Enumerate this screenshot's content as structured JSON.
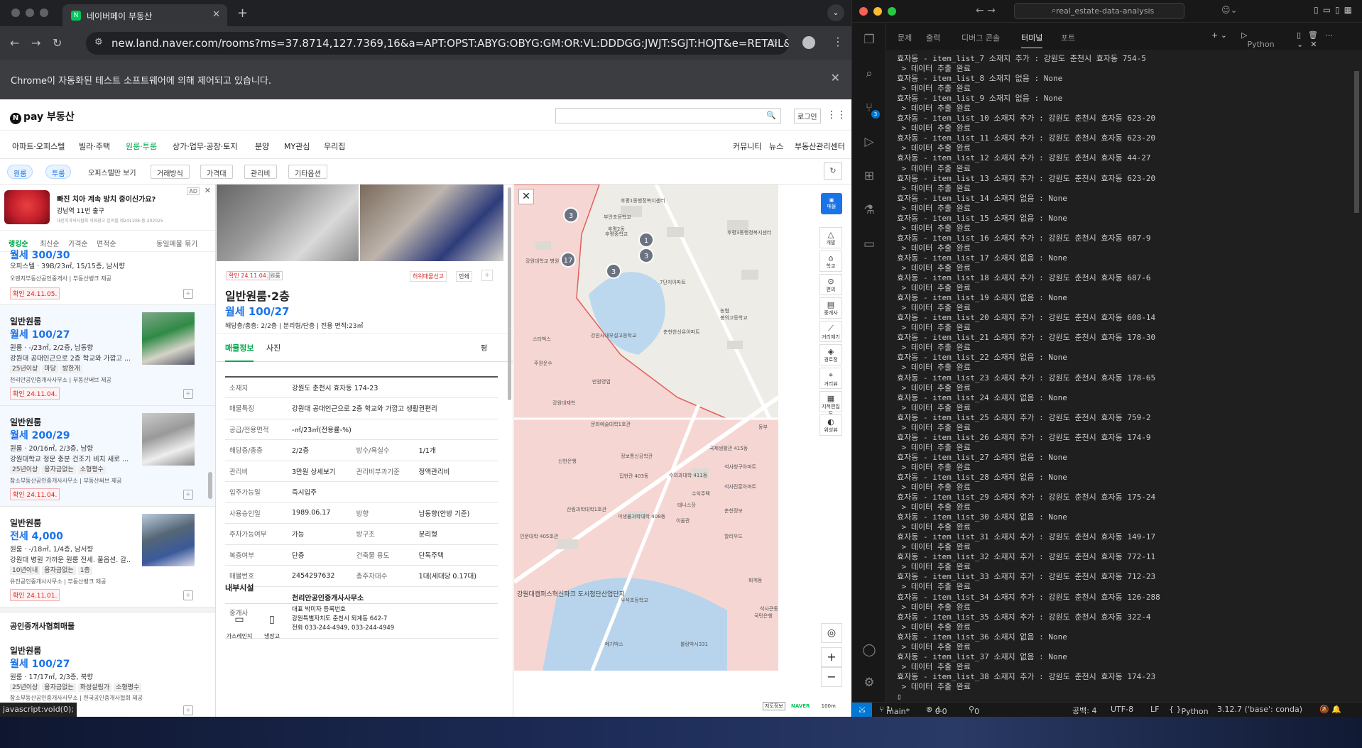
{
  "chrome": {
    "tab_title": "네이버페이 부동산",
    "url": "new.land.naver.com/rooms?ms=37.8714,127.7369,16&a=APT:OPST:ABYG:OBYG:GM:OR:VL:DDDGG:JWJT:SGJT:HOJT&e=RETAIL&aa=S...",
    "infobar": "Chrome이 자동화된 테스트 소프트웨어에 의해 제어되고 있습니다.",
    "status_url": "javascript:void(0);"
  },
  "naver": {
    "logo": "pay 부동산",
    "login": "로그인",
    "menu": [
      "아파트·오피스텔",
      "빌라·주택",
      "원룸·투룸",
      "상가·업무·공장·토지",
      "분양",
      "MY관심",
      "우리집"
    ],
    "menu_right": [
      "커뮤니티",
      "뉴스",
      "부동산관리센터"
    ],
    "filters": [
      "원룸",
      "투룸",
      "오피스텔만 보기",
      "거래방식",
      "가격대",
      "관리비",
      "기타옵션"
    ],
    "ad": {
      "title": "빠진 치아 계속 방치 중이신가요?",
      "sub": "강남역 11번 출구",
      "fine": "대한치과의사협회 의료광고 심의필 제241108-중-202025",
      "tag": "AD"
    },
    "sort": [
      "랭킹순",
      "최신순",
      "가격순",
      "면적순",
      "동일매물 묶기"
    ],
    "partial": {
      "price": "월세 300/30",
      "spec": "오피스텔 · 39B/23㎡, 15/15층, 남서향",
      "agent": "오렌지부동산공인중개사 | 부동산뱅크 제공",
      "confirm": "확인 24.11.05."
    },
    "listings": [
      {
        "title": "일반원룸",
        "price": "월세 100/27",
        "spec": "원룸 · -/23㎡, 2/2층, 남동향",
        "desc": "강원대 공대인근으로 2층 학교와 가깝고 ...",
        "tags": [
          "25년이상",
          "마당",
          "방한개"
        ],
        "agent": "천리안공인중개사사무소 | 부동산써브 제공",
        "confirm": "확인 24.11.04."
      },
      {
        "title": "일반원룸",
        "price": "월세 200/29",
        "spec": "원룸 · 20/16㎡, 2/3층, 남향",
        "desc": "강원대학교 정문 충분 건조기 비치 새로 ...",
        "tags": [
          "25년이상",
          "융자금없는",
          "소형평수"
        ],
        "agent": "참소부동산공인중개사사무소 | 부동산써브 제공",
        "confirm": "확인 24.11.04."
      },
      {
        "title": "일반원룸",
        "price": "전세 4,000",
        "spec": "원룸 · -/18㎡, 1/4층, 남서향",
        "desc": "강원대 병원 가까운 원룸 전세. 풀옵션. 갈...",
        "tags": [
          "10년이내",
          "융자금없는",
          "1층"
        ],
        "agent": "유진공인중개사사무소 | 부동산뱅크 제공",
        "confirm": "확인 24.11.01."
      }
    ],
    "section": "공인중개사협회매물",
    "bottom_listing": {
      "title": "일반원룸",
      "price": "월세 100/27",
      "spec": "원룸 · 17/17㎡, 2/3층, 북향",
      "tags": [
        "25년이상",
        "융자금없는",
        "화성살림가",
        "소형평수"
      ],
      "agent": "참소부동산공인중개사사무소 | 한국공인중개사협회 제공"
    },
    "detail": {
      "badge": "확인 24.11.04.",
      "badge2": "원룸",
      "report": "허위매물신고",
      "print": "인쇄",
      "title": "일반원룸·2층",
      "price": "월세 100/27",
      "summary": "해당층/총층: 2/2층 | 분리형/단층 | 전용 면적:23㎡",
      "tab1": "매물정보",
      "tab2": "사진",
      "pyeong": "평",
      "rows": [
        {
          "k": "소재지",
          "v": "강원도 춘천시 효자동 174-23"
        },
        {
          "k": "매물특징",
          "v": "강원대 공대인근으로 2층 학교와 가깝고 생활권편리"
        },
        {
          "k": "공급/전용면적",
          "v": "-㎡/23㎡(전용률-%)"
        },
        {
          "k": "해당층/총층",
          "v": "2/2층",
          "k2": "방수/욕실수",
          "v2": "1/1개"
        },
        {
          "k": "관리비",
          "v": "3만원 상세보기",
          "k2": "관리비부과기준",
          "v2": "정액관리비"
        },
        {
          "k": "입주가능일",
          "v": "즉시입주"
        },
        {
          "k": "사용승인일",
          "v": "1989.06.17",
          "k2": "방향",
          "v2": "남동향(안방 기준)"
        },
        {
          "k": "주차가능여부",
          "v": "가능",
          "k2": "방구조",
          "v2": "분리형"
        },
        {
          "k": "복층여부",
          "v": "단층",
          "k2": "건축물 용도",
          "v2": "단독주택"
        },
        {
          "k": "매물번호",
          "v": "2454297632",
          "k2": "총주차대수",
          "v2": "1대(세대당 0.17대)"
        }
      ],
      "agent_key": "중개사",
      "agent_name": "천리안공인중개사사무소",
      "agent_lines": [
        "대표 박미자 등록번호",
        "강원특별자치도 춘천시 퇴계동 642-7",
        "전화 033-244-4949, 033-244-4949"
      ],
      "inner": "내부시설",
      "facilities": [
        "가스레인지",
        "냉장고"
      ]
    },
    "map": {
      "labels": [
        "스타벅스",
        "강원대학교 병원",
        "주원운수",
        "강원사대부설고등학교",
        "후평2동",
        "부안초등학교",
        "후평중학교",
        "7단지아파트",
        "춘천한신유아파트",
        "봉의고등학교",
        "농협",
        "강원대재학",
        "만원영업",
        "문화예술대학1호관",
        "정보통신공학관",
        "신한은행",
        "집현관 403동",
        "수의과대학 411동",
        "수익주택",
        "인문대학 405호관",
        "산림과학대학1호관",
        "미생물과학대학 408동",
        "국제생활관 415동",
        "테니스장",
        "이울관",
        "석사청구아파트",
        "석사진흥아파트",
        "춘천정보",
        "할리우드",
        "석사큰동",
        "우석초등학교",
        "국민은행",
        "메가박스",
        "불랑박시331",
        "강원대캠퍼스혁신파크 도시첨단산업단지",
        "후평1동행정복지센터",
        "후평3동행정복지센터",
        "동부",
        "퇴계동"
      ],
      "clusters": [
        "3",
        "1",
        "3",
        "17",
        "3"
      ],
      "controls": [
        "매물",
        "개발",
        "학교",
        "편의",
        "중개사",
        "거리재기",
        "경로정",
        "거리뷰",
        "지적편집도",
        "위성뷰"
      ],
      "footer": [
        "지도정보",
        "NAVER",
        "100m"
      ]
    }
  },
  "vscode": {
    "search": "real_estate-data-analysis",
    "panel_tabs": [
      "문제",
      "출력",
      "디버그 콘솔",
      "터미널",
      "포트"
    ],
    "terminal_right": "Python",
    "status": {
      "branch": "main*",
      "errors": "0",
      "warnings": "0",
      "ports": "0",
      "spaces": "공백: 4",
      "encoding": "UTF-8",
      "eol": "LF",
      "lang": "Python",
      "interp": "3.12.7 ('base': conda)"
    },
    "terminal_lines": [
      "효자동 - item_list_7 소재지 추가 : 강원도 춘천시 효자동 754-5",
      " > 데이터 추출 완료",
      "효자동 - item_list_8 소재지 없음 : None",
      " > 데이터 추출 완료",
      "효자동 - item_list_9 소재지 없음 : None",
      " > 데이터 추출 완료",
      "효자동 - item_list_10 소재지 추가 : 강원도 춘천시 효자동 623-20",
      " > 데이터 추출 완료",
      "효자동 - item_list_11 소재지 추가 : 강원도 춘천시 효자동 623-20",
      " > 데이터 추출 완료",
      "효자동 - item_list_12 소재지 추가 : 강원도 춘천시 효자동 44-27",
      " > 데이터 추출 완료",
      "효자동 - item_list_13 소재지 추가 : 강원도 춘천시 효자동 623-20",
      " > 데이터 추출 완료",
      "효자동 - item_list_14 소재지 없음 : None",
      " > 데이터 추출 완료",
      "효자동 - item_list_15 소재지 없음 : None",
      " > 데이터 추출 완료",
      "효자동 - item_list_16 소재지 추가 : 강원도 춘천시 효자동 687-9",
      " > 데이터 추출 완료",
      "효자동 - item_list_17 소재지 없음 : None",
      " > 데이터 추출 완료",
      "효자동 - item_list_18 소재지 추가 : 강원도 춘천시 효자동 687-6",
      " > 데이터 추출 완료",
      "효자동 - item_list_19 소재지 없음 : None",
      " > 데이터 추출 완료",
      "효자동 - item_list_20 소재지 추가 : 강원도 춘천시 효자동 608-14",
      " > 데이터 추출 완료",
      "효자동 - item_list_21 소재지 추가 : 강원도 춘천시 효자동 178-30",
      " > 데이터 추출 완료",
      "효자동 - item_list_22 소재지 없음 : None",
      " > 데이터 추출 완료",
      "효자동 - item_list_23 소재지 추가 : 강원도 춘천시 효자동 178-65",
      " > 데이터 추출 완료",
      "효자동 - item_list_24 소재지 없음 : None",
      " > 데이터 추출 완료",
      "효자동 - item_list_25 소재지 추가 : 강원도 춘천시 효자동 759-2",
      " > 데이터 추출 완료",
      "효자동 - item_list_26 소재지 추가 : 강원도 춘천시 효자동 174-9",
      " > 데이터 추출 완료",
      "효자동 - item_list_27 소재지 없음 : None",
      " > 데이터 추출 완료",
      "효자동 - item_list_28 소재지 없음 : None",
      " > 데이터 추출 완료",
      "효자동 - item_list_29 소재지 추가 : 강원도 춘천시 효자동 175-24",
      " > 데이터 추출 완료",
      "효자동 - item_list_30 소재지 없음 : None",
      " > 데이터 추출 완료",
      "효자동 - item_list_31 소재지 추가 : 강원도 춘천시 효자동 149-17",
      " > 데이터 추출 완료",
      "효자동 - item_list_32 소재지 추가 : 강원도 춘천시 효자동 772-11",
      " > 데이터 추출 완료",
      "효자동 - item_list_33 소재지 추가 : 강원도 춘천시 효자동 712-23",
      " > 데이터 추출 완료",
      "효자동 - item_list_34 소재지 추가 : 강원도 춘천시 효자동 126-288",
      " > 데이터 추출 완료",
      "효자동 - item_list_35 소재지 추가 : 강원도 춘천시 효자동 322-4",
      " > 데이터 추출 완료",
      "효자동 - item_list_36 소재지 없음 : None",
      " > 데이터 추출 완료",
      "효자동 - item_list_37 소재지 없음 : None",
      " > 데이터 추출 완료",
      "효자동 - item_list_38 소재지 추가 : 강원도 춘천시 효자동 174-23",
      " > 데이터 추출 완료"
    ]
  }
}
